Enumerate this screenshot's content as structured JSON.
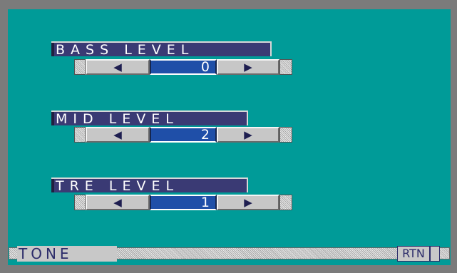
{
  "screen": {
    "background_color": "#009b98",
    "frame_color": "#7b7b7b"
  },
  "bass": {
    "label": "BASS LEVEL",
    "value": "0",
    "decrease_icon": "triangle-left-icon",
    "increase_icon": "triangle-right-icon",
    "decrease_glyph": "◀",
    "increase_glyph": "▶"
  },
  "mid": {
    "label": "MID LEVEL",
    "value": "2",
    "decrease_icon": "triangle-left-icon",
    "increase_icon": "triangle-right-icon",
    "decrease_glyph": "◀",
    "increase_glyph": "▶"
  },
  "tre": {
    "label": "TRE LEVEL",
    "value": "1",
    "decrease_icon": "triangle-left-icon",
    "increase_icon": "triangle-right-icon",
    "decrease_glyph": "◀",
    "increase_glyph": "▶"
  },
  "footer": {
    "title": "TONE",
    "return_label": "RTN"
  },
  "colors": {
    "label_bg": "#3a3a74",
    "value_bg": "#1f4fa8",
    "button_bg": "#c7c7c7",
    "text_dark": "#2c2c6a"
  }
}
